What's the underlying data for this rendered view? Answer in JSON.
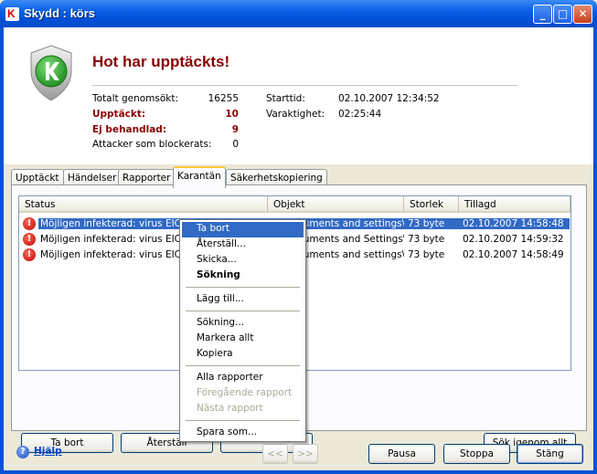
{
  "window": {
    "title": "Skydd : körs",
    "icon_letter": "K",
    "min": "_",
    "max": "□",
    "close": "✕"
  },
  "header": {
    "heading": "Hot har upptäckts!"
  },
  "stats": {
    "scanned_label": "Totalt genomsökt:",
    "scanned_value": "16255",
    "detected_label": "Upptäckt:",
    "detected_value": "10",
    "untreated_label": "Ej behandlad:",
    "untreated_value": "9",
    "blocked_label": "Attacker som blockerats:",
    "blocked_value": "0",
    "start_label": "Starttid:",
    "start_value": "02.10.2007 12:34:52",
    "duration_label": "Varaktighet:",
    "duration_value": "02:25:44"
  },
  "tabs": [
    "Upptäckt",
    "Händelser",
    "Rapporter",
    "Karantän",
    "Säkerhetskopiering"
  ],
  "active_tab": "Karantän",
  "table": {
    "columns": [
      "Status",
      "Objekt",
      "Storlek",
      "Tillagd"
    ],
    "rows": [
      {
        "status": "Möjligen infekterad: virus EICAR-Test-File",
        "object": "C:\\Documents and settings\\...",
        "size": "73 byte",
        "added": "02.10.2007 14:58:48",
        "selected": true
      },
      {
        "status": "Möjligen infekterad: virus EICAR-Test-File",
        "object": "C:\\Documents and Settings\\...",
        "size": "73 byte",
        "added": "02.10.2007 14:59:32",
        "selected": false
      },
      {
        "status": "Möjligen infekterad: virus EICAR-Test-File",
        "object": "C:\\Documents and settings\\...",
        "size": "73 byte",
        "added": "02.10.2007 14:58:49",
        "selected": false
      }
    ]
  },
  "context_menu": {
    "delete": "Ta bort",
    "restore": "Återställ...",
    "send": "Skicka...",
    "scan_bold": "Sökning",
    "add": "Lägg till...",
    "search": "Sökning...",
    "select_all": "Markera allt",
    "copy": "Kopiera",
    "all_reports": "Alla rapporter",
    "prev_report": "Föregående rapport",
    "next_report": "Nästa rapport",
    "save_as": "Spara som..."
  },
  "panel_buttons": {
    "delete": "Ta bort",
    "restore": "Återställ",
    "scan_all": "Sök igenom allt"
  },
  "footer": {
    "help": "Hjälp",
    "prev": "<<",
    "next": ">>",
    "pause": "Pausa",
    "stop": "Stoppa",
    "close": "Stäng"
  }
}
